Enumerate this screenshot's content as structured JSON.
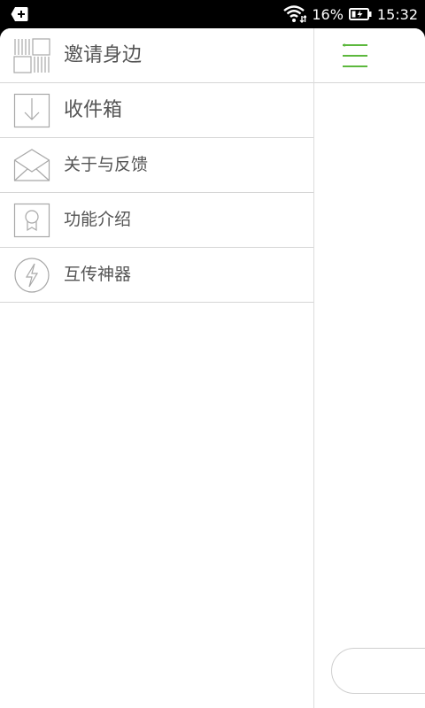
{
  "status_bar": {
    "battery_percent": "16%",
    "time": "15:32"
  },
  "drawer": {
    "items": [
      {
        "label": "邀请身边",
        "icon": "qr-grid-icon"
      },
      {
        "label": "收件箱",
        "icon": "download-tray-icon"
      },
      {
        "label": "关于与反馈",
        "icon": "envelope-icon"
      },
      {
        "label": "功能介绍",
        "icon": "award-badge-icon"
      },
      {
        "label": "互传神器",
        "icon": "lightning-icon"
      }
    ]
  },
  "colors": {
    "accent": "#5cb83d",
    "icon_gray": "#a8a8a8",
    "text": "#555555",
    "divider": "#d5d5d5"
  }
}
